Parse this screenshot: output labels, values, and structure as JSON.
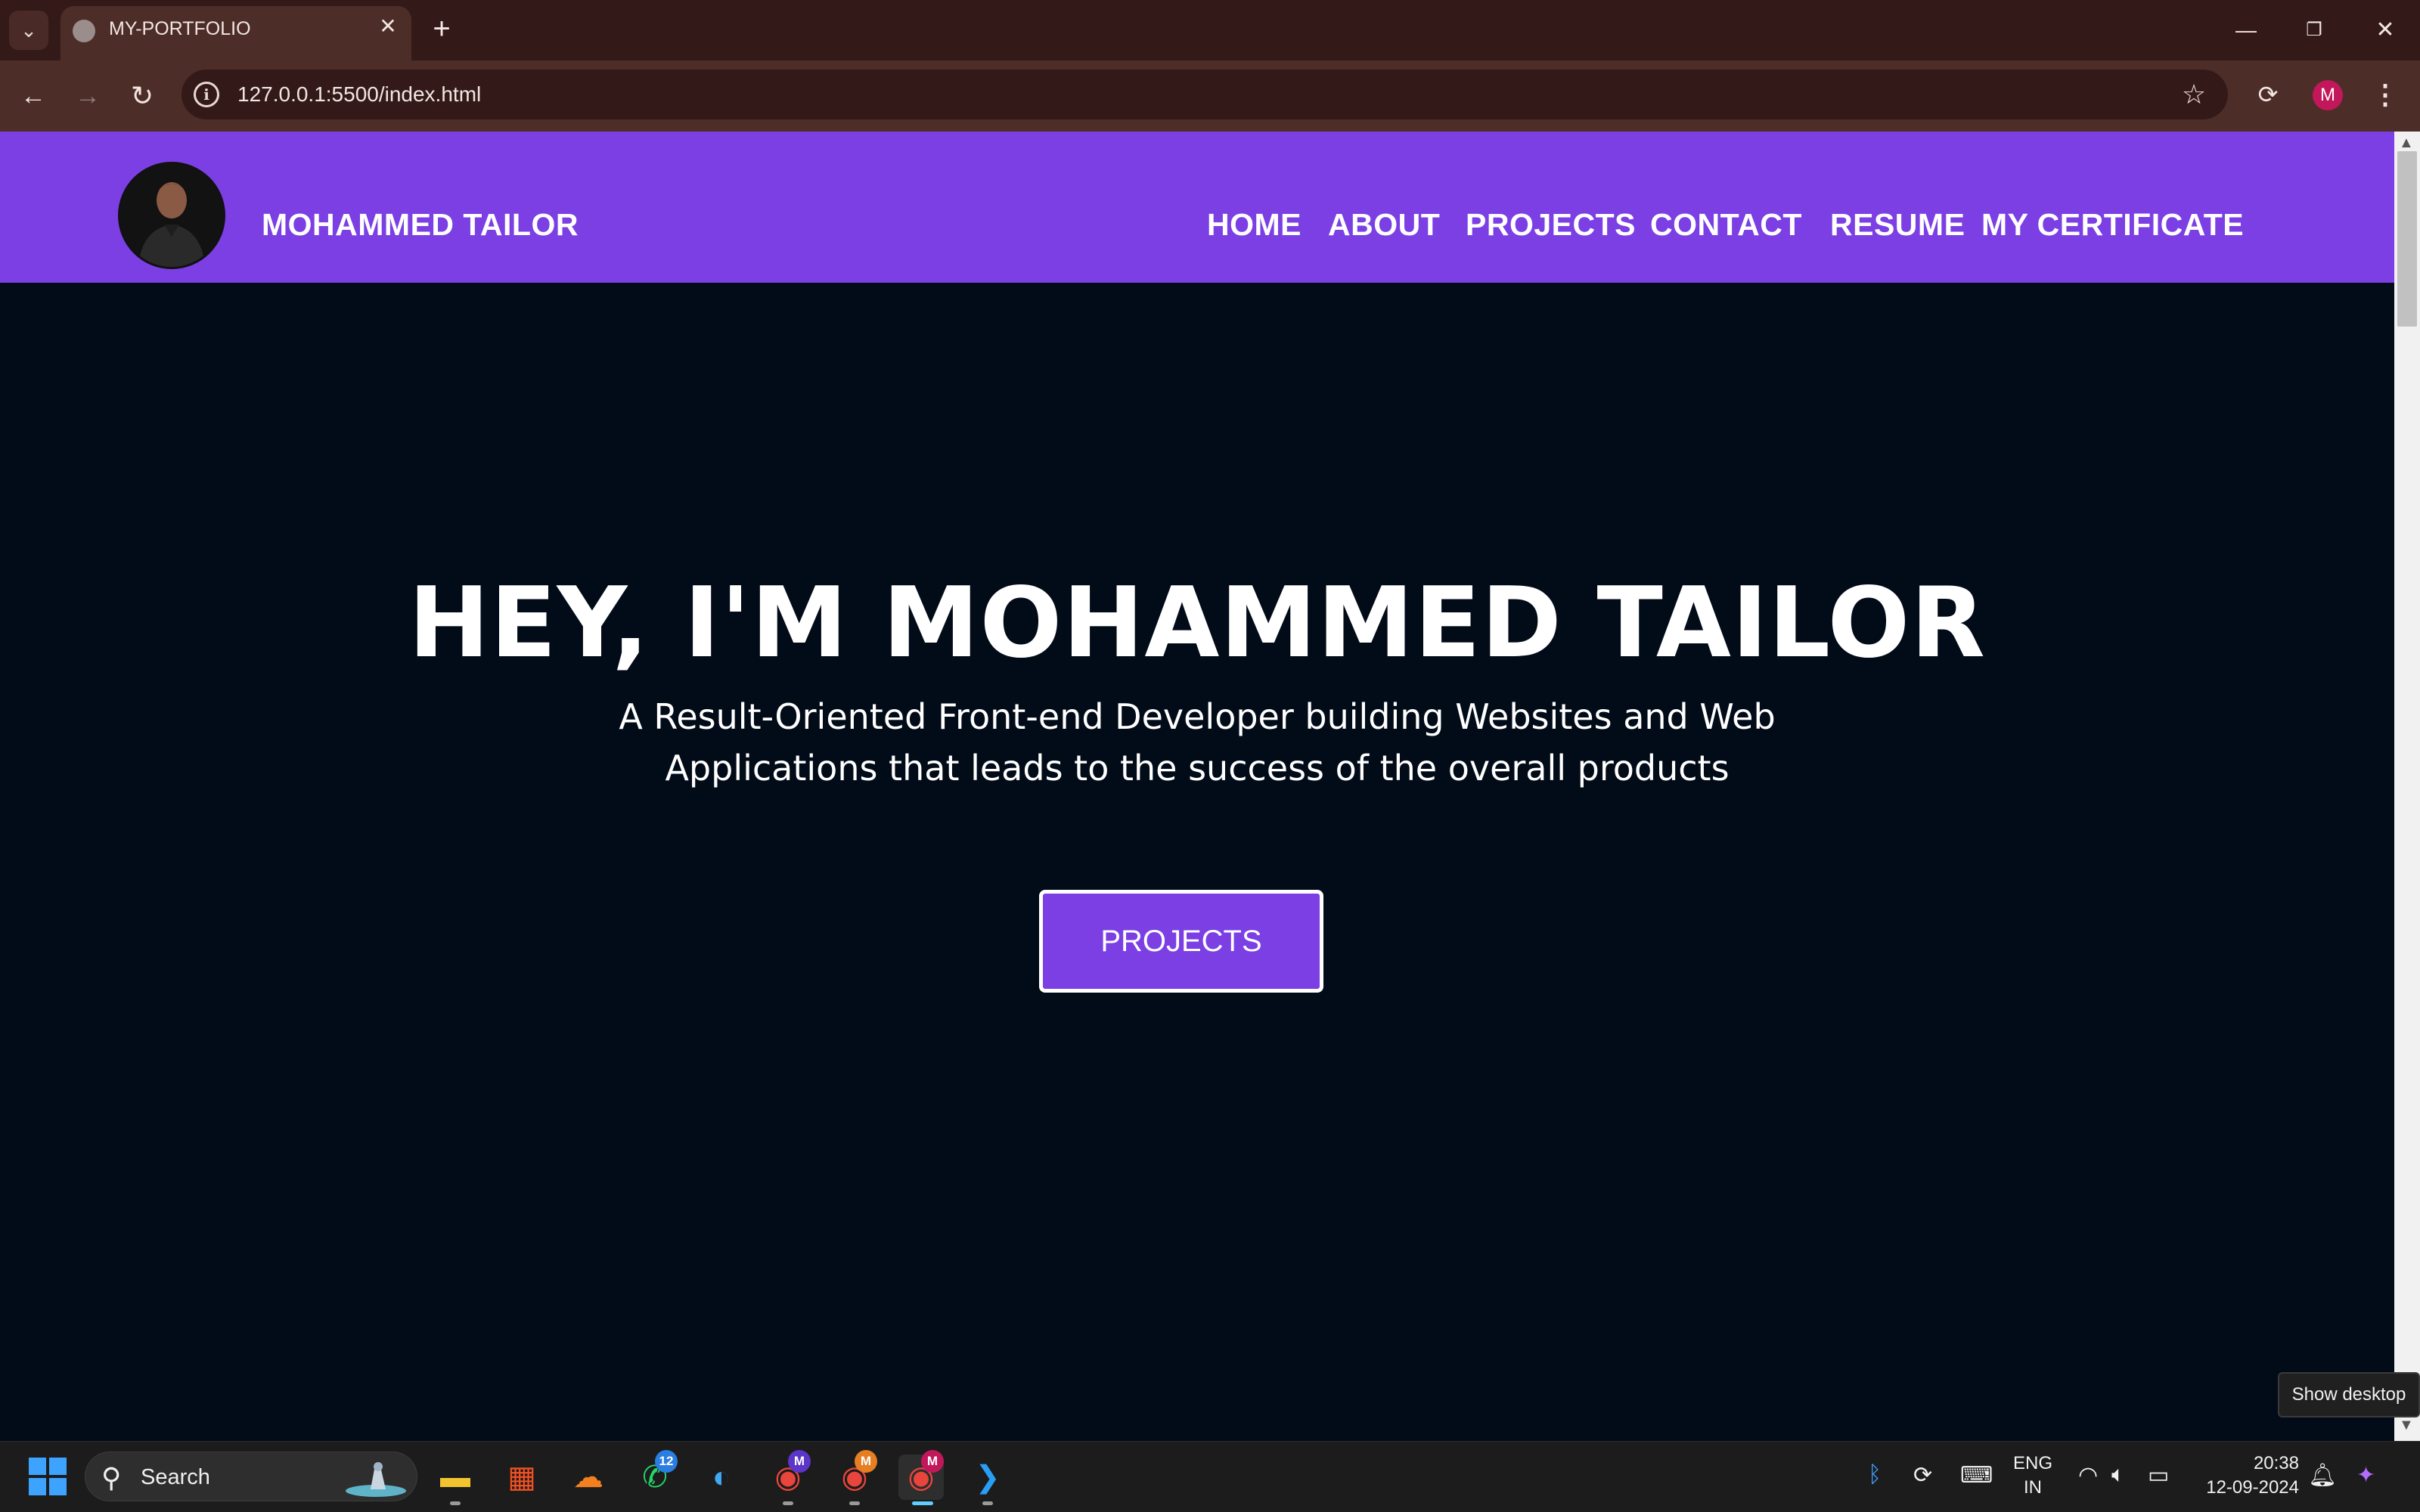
{
  "browser": {
    "tab_title": "MY-PORTFOLIO",
    "url": "127.0.0.1:5500/index.html",
    "profile_initial": "M",
    "icons": {
      "tab_menu": "chevron-down-icon",
      "tab_close": "close-icon",
      "new_tab": "plus-icon",
      "back": "arrow-left-icon",
      "forward": "arrow-right-icon",
      "reload": "reload-icon",
      "site_info": "info-icon",
      "bookmark": "star-icon",
      "extension": "extension-icon",
      "menu": "more-vertical-icon"
    }
  },
  "site": {
    "brand": "MOHAMMED TAILOR",
    "nav": [
      "HOME",
      "ABOUT",
      "PROJECTS",
      "CONTACT",
      "RESUME",
      "MY CERTIFICATE"
    ],
    "hero": {
      "title": "HEY, I'M MOHAMMED TAILOR",
      "subtitle_line1": "A Result-Oriented Front-end Developer building Websites and Web",
      "subtitle_line2": "Applications that leads to the success of the overall products",
      "button": "PROJECTS"
    },
    "colors": {
      "nav_bg": "#7b3fe4",
      "page_bg": "#020b18",
      "button_bg": "#7b3fe4"
    }
  },
  "tooltip": "Show desktop",
  "taskbar": {
    "search_label": "Search",
    "apps": [
      {
        "name": "file-explorer-icon"
      },
      {
        "name": "microsoft-store-icon"
      },
      {
        "name": "cloudflare-icon"
      },
      {
        "name": "whatsapp-icon",
        "badge": "12"
      },
      {
        "name": "edge-icon"
      },
      {
        "name": "chrome-profile-1-icon",
        "badge": "M"
      },
      {
        "name": "chrome-profile-2-icon",
        "badge": "M"
      },
      {
        "name": "chrome-profile-3-icon",
        "badge": "M"
      },
      {
        "name": "vscode-icon"
      }
    ],
    "language_line1": "ENG",
    "language_line2": "IN",
    "time": "20:38",
    "date": "12-09-2024"
  }
}
